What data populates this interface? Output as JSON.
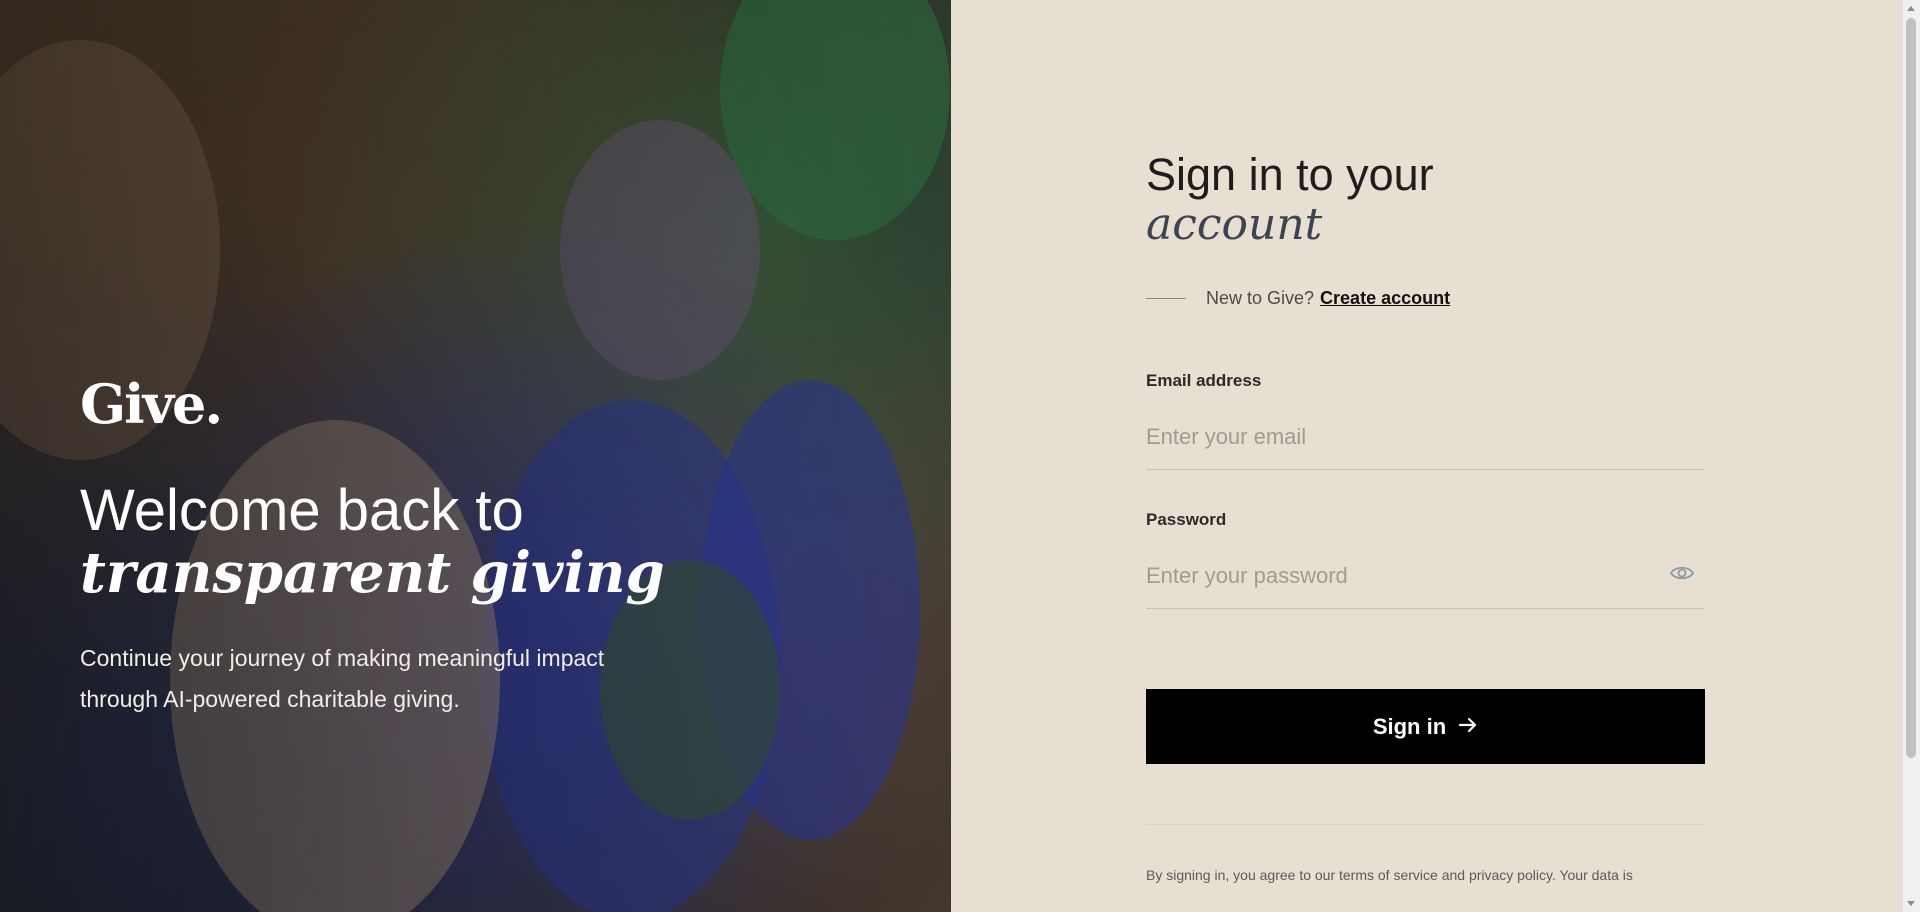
{
  "hero": {
    "logo": "Give.",
    "title_line1": "Welcome back to",
    "title_line2": "transparent giving",
    "subtitle": "Continue your journey of making meaningful impact through AI-powered charitable giving."
  },
  "form": {
    "title_line1": "Sign in to your",
    "title_line2": "account",
    "new_prompt": "New to Give?",
    "create_account": "Create account",
    "email_label": "Email address",
    "email_placeholder": "Enter your email",
    "password_label": "Password",
    "password_placeholder": "Enter your password",
    "signin_label": "Sign in",
    "terms": "By signing in, you agree to our terms of service and privacy policy. Your data is"
  },
  "icons": {
    "password_toggle": "eye-icon",
    "signin_arrow": "arrow-right-icon"
  },
  "colors": {
    "panel_bg": "#e6dfd2",
    "button_bg": "#000000",
    "accent_text": "#3d4350"
  }
}
